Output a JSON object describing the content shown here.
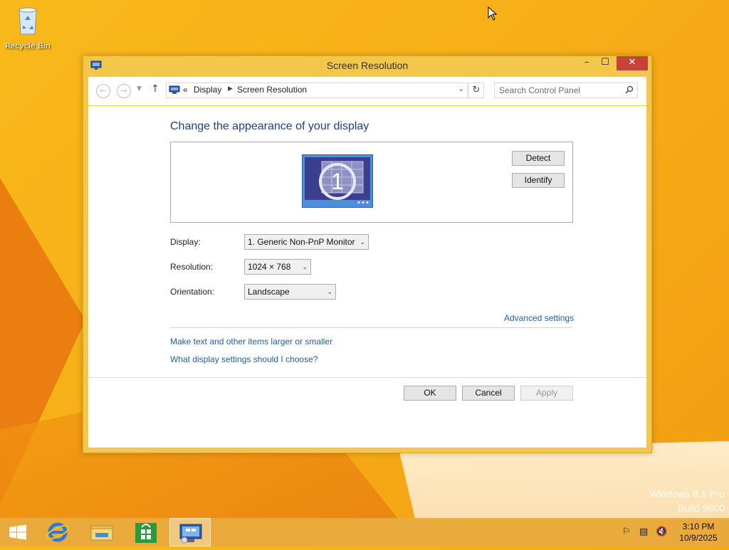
{
  "desktop": {
    "recycle_bin_label": "Recycle Bin",
    "watermark_line1": "Windows 8.1 Pro",
    "watermark_line2": "Build 9600"
  },
  "window": {
    "title": "Screen Resolution",
    "minimize": "–",
    "maximize": "☐",
    "close": "✕"
  },
  "address": {
    "back": "←",
    "forward": "→",
    "up": "↑",
    "prefix": "«",
    "crumbs": [
      "Display",
      "Screen Resolution"
    ],
    "refresh": "↻",
    "search_placeholder": "Search Control Panel"
  },
  "main": {
    "heading": "Change the appearance of your display",
    "monitor_number": "1",
    "detect_label": "Detect",
    "identify_label": "Identify",
    "display_label": "Display:",
    "display_value": "1. Generic Non-PnP Monitor",
    "resolution_label": "Resolution:",
    "resolution_value": "1024 × 768",
    "orientation_label": "Orientation:",
    "orientation_value": "Landscape",
    "advanced_link": "Advanced settings",
    "link_text_size": "Make text and other items larger or smaller",
    "link_which_settings": "What display settings should I choose?"
  },
  "footer": {
    "ok_label": "OK",
    "cancel_label": "Cancel",
    "apply_label": "Apply"
  },
  "taskbar": {
    "apps": [
      "start-icon",
      "internet-explorer-icon",
      "file-explorer-icon",
      "store-icon",
      "screen-resolution-icon"
    ],
    "clock_time": "3:10 PM",
    "clock_date": "10/9/2025"
  },
  "colors": {
    "accent_link": "#1e5fa8",
    "heading": "#1e3f87",
    "close_button": "#c7423a",
    "window_frame": "#f3c74a"
  }
}
